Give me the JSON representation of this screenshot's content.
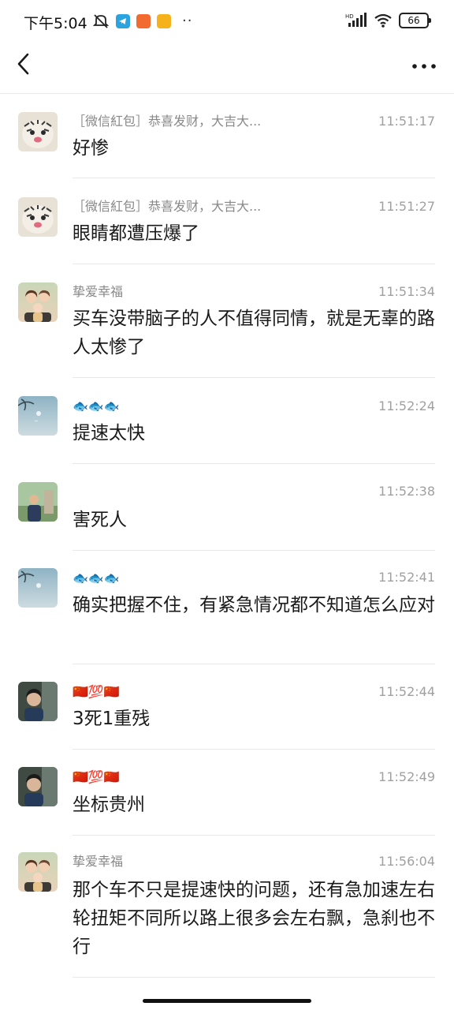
{
  "status_bar": {
    "time": "下午5:04",
    "dots": "··",
    "battery": "66"
  },
  "messages": [
    {
      "sender": "［微信紅包］恭喜发财，大吉大...",
      "time": "11:51:17",
      "text": "好惨",
      "avatar": "tiger"
    },
    {
      "sender": "［微信紅包］恭喜发财，大吉大...",
      "time": "11:51:27",
      "text": "眼睛都遭压爆了",
      "avatar": "tiger"
    },
    {
      "sender": "挚爱幸福",
      "time": "11:51:34",
      "text": "买车没带脑子的人不值得同情，就是无辜的路人太惨了",
      "avatar": "family"
    },
    {
      "sender": "🐟🐟🐟",
      "time": "11:52:24",
      "text": "提速太快",
      "avatar": "sky"
    },
    {
      "sender": "",
      "time": "11:52:38",
      "text": "害死人",
      "avatar": "man"
    },
    {
      "sender": "🐟🐟🐟",
      "time": "11:52:41",
      "text": "确实把握不住，有紧急情况都不知道怎么应对",
      "avatar": "sky"
    },
    {
      "sender": "🇨🇳💯🇨🇳",
      "time": "11:52:44",
      "text": "3死1重残",
      "avatar": "guy"
    },
    {
      "sender": "🇨🇳💯🇨🇳",
      "time": "11:52:49",
      "text": "坐标贵州",
      "avatar": "guy"
    },
    {
      "sender": "挚爱幸福",
      "time": "11:56:04",
      "text": "那个车不只是提速快的问题，还有急加速左右轮扭矩不同所以路上很多会左右飘，急刹也不行",
      "avatar": "family"
    }
  ]
}
